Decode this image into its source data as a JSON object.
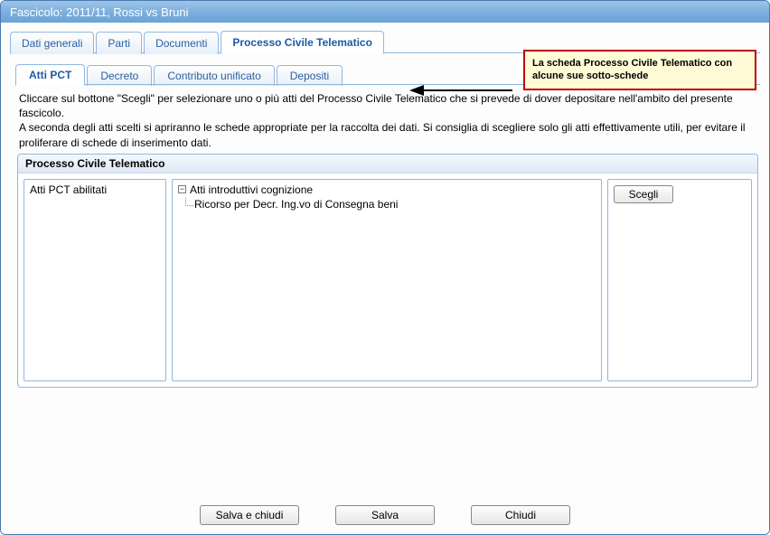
{
  "window": {
    "title": "Fascicolo: 2011/11, Rossi vs Bruni"
  },
  "main_tabs": [
    {
      "label": "Dati generali",
      "active": false
    },
    {
      "label": "Parti",
      "active": false
    },
    {
      "label": "Documenti",
      "active": false
    },
    {
      "label": "Processo Civile Telematico",
      "active": true
    }
  ],
  "sub_tabs": [
    {
      "label": "Atti PCT",
      "active": true
    },
    {
      "label": "Decreto",
      "active": false
    },
    {
      "label": "Contributo unificato",
      "active": false
    },
    {
      "label": "Depositi",
      "active": false
    }
  ],
  "instructions": {
    "line1": "Cliccare sul bottone \"Scegli\" per selezionare uno o più atti del Processo Civile Telematico che si prevede di dover depositare nell'ambito del presente fascicolo.",
    "line2": "A seconda degli atti scelti si apriranno le schede appropriate per la raccolta dei dati. Si consiglia di scegliere solo gli atti effettivamente utili, per evitare il proliferare di schede di inserimento dati."
  },
  "group": {
    "title": "Processo Civile Telematico",
    "left_label": "Atti PCT abilitati",
    "tree_root": "Atti introduttivi cognizione",
    "tree_child": "Ricorso per Decr. Ing.vo di Consegna beni",
    "choose_label": "Scegli"
  },
  "buttons": {
    "save_close": "Salva e chiudi",
    "save": "Salva",
    "close": "Chiudi"
  },
  "callout": {
    "text": "La scheda Processo Civile Telematico con alcune sue sotto-schede"
  }
}
